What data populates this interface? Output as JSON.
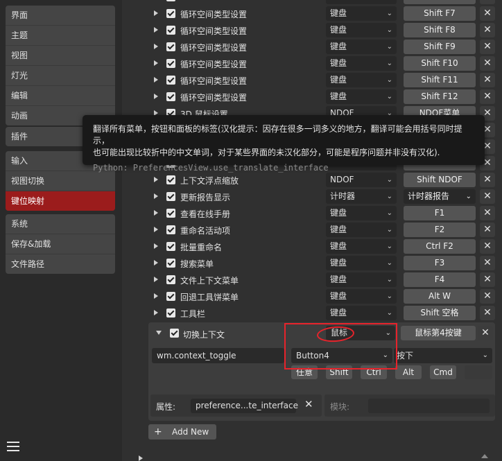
{
  "sidebar": {
    "group1": [
      "界面",
      "主题",
      "视图",
      "灯光",
      "编辑",
      "动画"
    ],
    "group2": [
      "插件"
    ],
    "group3": [
      "输入",
      "视图切换",
      "键位映射"
    ],
    "group4": [
      "系统",
      "保存&加载",
      "文件路径"
    ],
    "active": "键位映射"
  },
  "rows": [
    {
      "label": "循环空间类型设置",
      "type": "键盘",
      "key": "Shift F7"
    },
    {
      "label": "循环空间类型设置",
      "type": "键盘",
      "key": "Shift F8"
    },
    {
      "label": "循环空间类型设置",
      "type": "键盘",
      "key": "Shift F9"
    },
    {
      "label": "循环空间类型设置",
      "type": "键盘",
      "key": "Shift F10"
    },
    {
      "label": "循环空间类型设置",
      "type": "键盘",
      "key": "Shift F11"
    },
    {
      "label": "循环空间类型设置",
      "type": "键盘",
      "key": "Shift F12"
    },
    {
      "label": "3D 鼠标设置",
      "type": "NDOF",
      "key": "NDOF菜单"
    },
    {
      "label": "上下文浮点缩放",
      "type": "NDOF",
      "key": "Shift NDOF Minus"
    },
    {
      "label": "更新报告显示",
      "type": "计时器",
      "key": "计时器报告"
    },
    {
      "label": "查看在线手册",
      "type": "键盘",
      "key": "F1"
    },
    {
      "label": "重命名活动项",
      "type": "键盘",
      "key": "F2"
    },
    {
      "label": "批量重命名",
      "type": "键盘",
      "key": "Ctrl F2"
    },
    {
      "label": "搜索菜单",
      "type": "键盘",
      "key": "F3"
    },
    {
      "label": "文件上下文菜单",
      "type": "键盘",
      "key": "F4"
    },
    {
      "label": "回退工具饼菜单",
      "type": "键盘",
      "key": "Alt W"
    },
    {
      "label": "工具栏",
      "type": "键盘",
      "key": "Shift 空格"
    }
  ],
  "tooltip": {
    "line1": "翻译所有菜单，按钮和面板的标签(汉化提示：因存在很多一词多义的地方，翻译可能会用括号同时提示，",
    "line2": "也可能出现比较折中的中文单词，对于某些界面的未汉化部分，可能是程序问题并非没有汉化).",
    "python": "Python: PreferencesView.use_translate_interface"
  },
  "expanded": {
    "label": "切换上下文",
    "type": "鼠标",
    "key": "鼠标第4按键",
    "operator": "wm.context_toggle",
    "button": "Button4",
    "event": "按下",
    "modifiers": [
      "任意",
      "Shift",
      "Ctrl",
      "Alt",
      "Cmd"
    ],
    "property_label": "属性:",
    "property_value": "preference...te_interface",
    "module_label": "模块:"
  },
  "add_new": "Add New",
  "colors": {
    "accent": "#9b1c1c",
    "annotation": "#e8232b"
  }
}
